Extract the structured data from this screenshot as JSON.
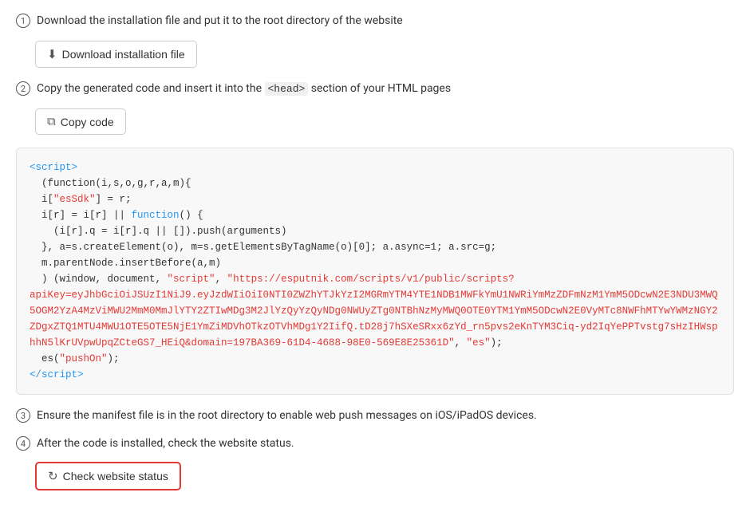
{
  "steps": [
    {
      "number": "1",
      "text": "Download the installation file and put it to the root directory of the website"
    },
    {
      "number": "2",
      "text_before": "Copy the generated code and insert it into the ",
      "code": "<head>",
      "text_after": " section of your HTML pages"
    },
    {
      "number": "3",
      "text": "Ensure the manifest file is in the root directory to enable web push messages on iOS/iPadOS devices."
    },
    {
      "number": "4",
      "text": "After the code is installed, check the website status."
    }
  ],
  "buttons": {
    "download": "Download installation file",
    "copy": "Copy code",
    "check": "Check website status"
  },
  "code": {
    "line1": "<script>",
    "line2": "  (function(i,s,o,g,r,a,m){",
    "line3": "  i[\"esSdk\"] = r;",
    "line4": "  i[r] = i[r] || function() {",
    "line5": "    (i[r].q = i[r].q || []).push(arguments)",
    "line6": "  }, a=s.createElement(o), m=s.getElementsByTagName(o)[0]; a.async=1; a.src=g;",
    "line7": "  m.parentNode.insertBefore(a,m)",
    "line8_pre": "  ) (window, document, \"script\", \"https://esputnik.com/scripts/v1/public/scripts?",
    "line8_key": "apiKey=eyJhbGciOiJSUzI1NiJ9.eyJzdWIiOiI0NTI0ZWZhYTJkYzI2MGRmYTM4YTE1NDB1MWFkYmU1NWRiYmMzZDFmNzM1YmM5ODcwN2E3NDU3MWQ5OGM2YzA4MzViMWU2MmM0MmJlYTY2ZTIwMDg3M2JlYzQyYzQyNDg0NWUyZTg0NTBhNzMyMWQ0OTE0YTM1YmM5ODcwN2E0VyMTc8NWFhMTYwYWMzNGY2ZDgxZTQ1MTU4MWU1OTE5OTE5NjE1YmZiMDVhOTkzOTVhMDg1Y2IifQ.tD28j7hSXeSRxx6zYd_rn5pvs2eKnTYM3Ciq-yd2IqYePPTvstg7sHzIHWsphhN5lKrUVpwUpqZCteGS7_HEiQ&domain=197BA369-61D4-4688-98E0-569E8E25361D",
    "line8_end": "\", \"es\");",
    "line9": "  es(\"pushOn\");",
    "line10": "<\\/script>"
  }
}
